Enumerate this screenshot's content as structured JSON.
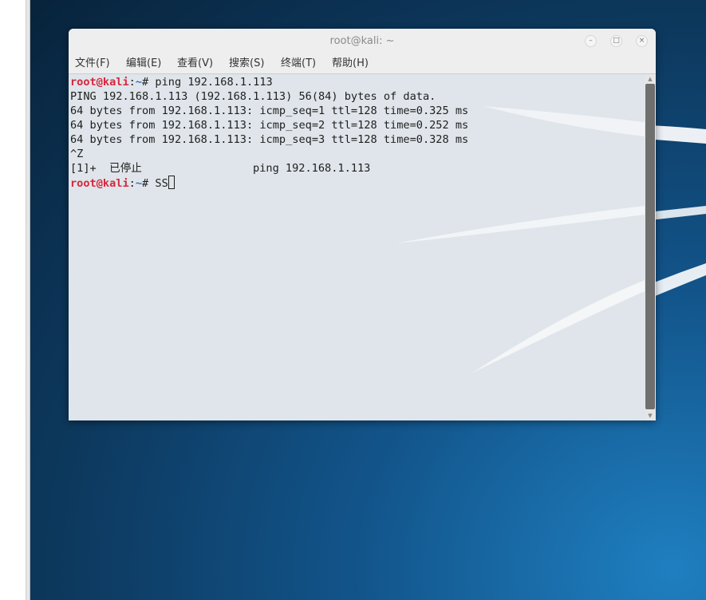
{
  "window": {
    "title": "root@kali: ~",
    "minimize_glyph": "–",
    "maximize_glyph": "□",
    "close_glyph": "×"
  },
  "menu": [
    {
      "label": "文件(F)"
    },
    {
      "label": "编辑(E)"
    },
    {
      "label": "查看(V)"
    },
    {
      "label": "搜索(S)"
    },
    {
      "label": "终端(T)"
    },
    {
      "label": "帮助(H)"
    }
  ],
  "terminal": {
    "prompt_user": "root@kali",
    "prompt_sep": ":",
    "prompt_path": "~",
    "prompt_symbol": "# ",
    "command1": "ping 192.168.1.113",
    "output": [
      "PING 192.168.1.113 (192.168.1.113) 56(84) bytes of data.",
      "64 bytes from 192.168.1.113: icmp_seq=1 ttl=128 time=0.325 ms",
      "64 bytes from 192.168.1.113: icmp_seq=2 ttl=128 time=0.252 ms",
      "64 bytes from 192.168.1.113: icmp_seq=3 ttl=128 time=0.328 ms",
      "^Z",
      "[1]+  已停止                 ping 192.168.1.113"
    ],
    "current_input": "SS"
  },
  "colors": {
    "prompt_user": "#d7263d",
    "prompt_path": "#3a6fc4",
    "terminal_bg": "#dfe5ea",
    "desktop_blue": "#12548a"
  },
  "icons": {
    "minimize": "minimize-icon",
    "maximize": "maximize-icon",
    "close": "close-icon",
    "scroll_up": "scroll-up-arrow-icon",
    "scroll_down": "scroll-down-arrow-icon"
  }
}
